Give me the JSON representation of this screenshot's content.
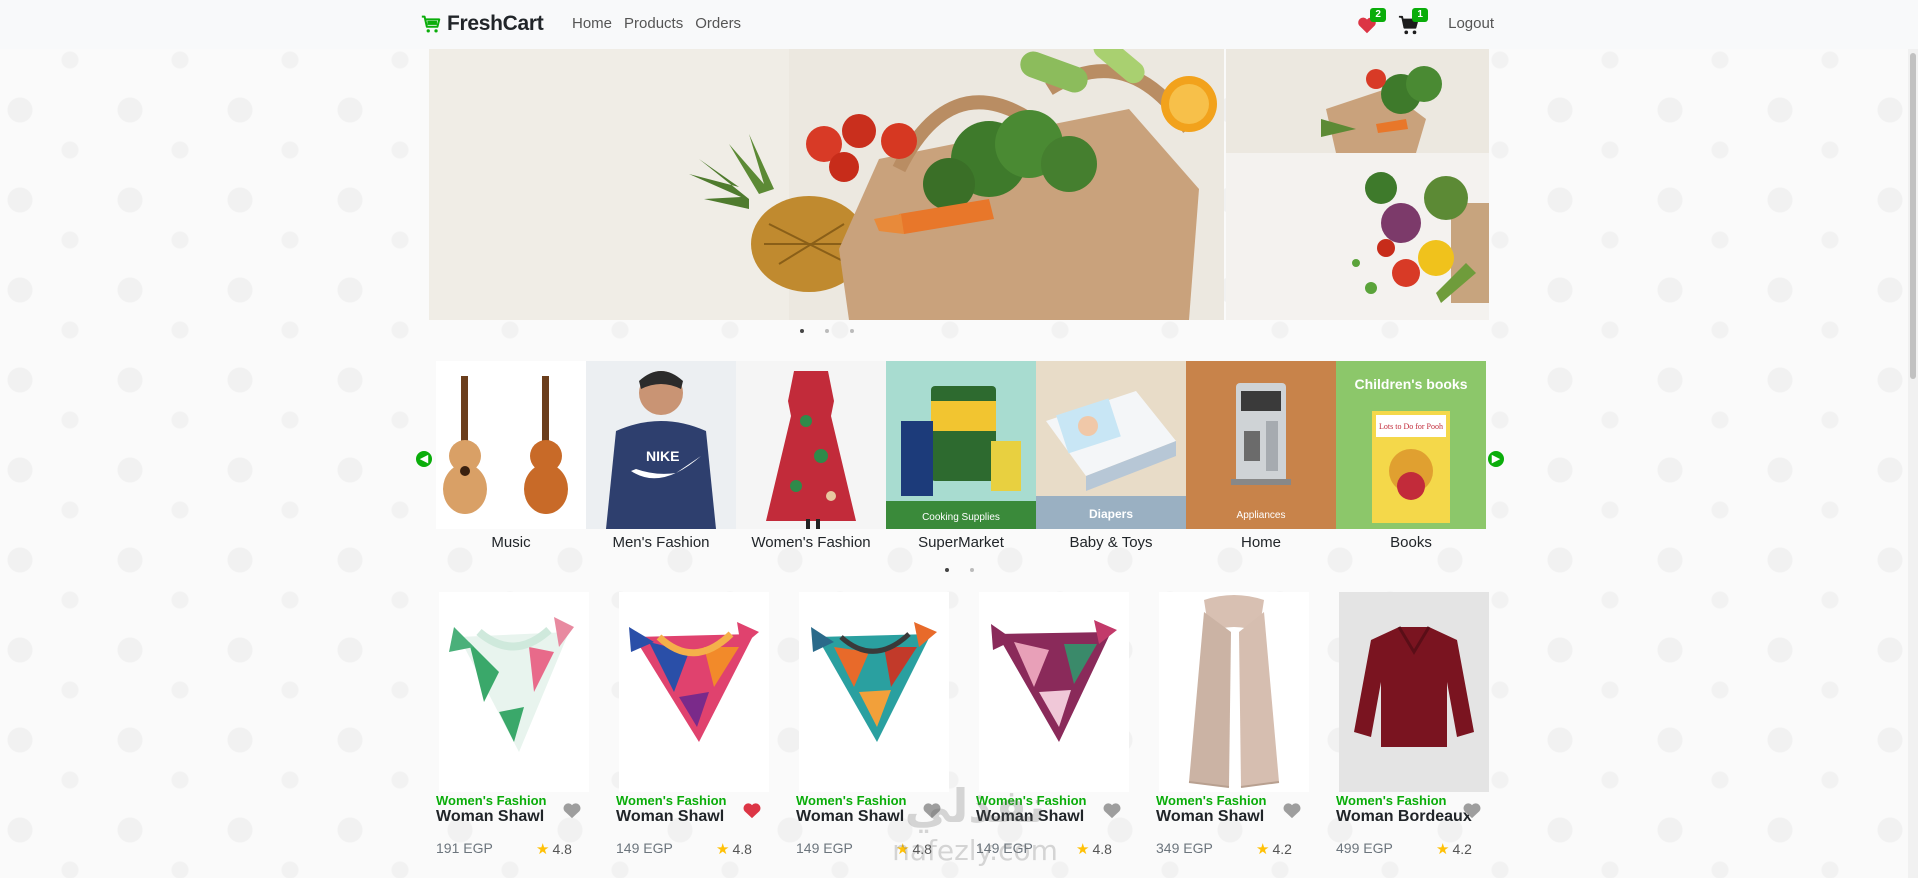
{
  "navbar": {
    "brand": "FreshCart",
    "links": [
      "Home",
      "Products",
      "Orders"
    ],
    "wishlist_count": "2",
    "cart_count": "1",
    "logout": "Logout"
  },
  "hero": {
    "dots": 3,
    "active_dot": 0
  },
  "categories": {
    "items": [
      "Music",
      "Men's Fashion",
      "Women's Fashion",
      "SuperMarket",
      "Baby & Toys",
      "Home",
      "Books"
    ],
    "image_captions": {
      "supermarket": "Cooking Supplies",
      "baby": "Diapers",
      "home": "Appliances",
      "books_banner": "Children's books",
      "book_cover": "Lots to Do for Pooh",
      "hoodie_brand": "NIKE"
    },
    "dots": 2,
    "active_dot": 0
  },
  "products": [
    {
      "category": "Women's Fashion",
      "name": "Woman Shawl",
      "price": "191 EGP",
      "rating": "4.8",
      "wishlisted": false
    },
    {
      "category": "Women's Fashion",
      "name": "Woman Shawl",
      "price": "149 EGP",
      "rating": "4.8",
      "wishlisted": true
    },
    {
      "category": "Women's Fashion",
      "name": "Woman Shawl",
      "price": "149 EGP",
      "rating": "4.8",
      "wishlisted": false
    },
    {
      "category": "Women's Fashion",
      "name": "Woman Shawl",
      "price": "149 EGP",
      "rating": "4.8",
      "wishlisted": false
    },
    {
      "category": "Women's Fashion",
      "name": "Woman Shawl",
      "price": "349 EGP",
      "rating": "4.2",
      "wishlisted": false
    },
    {
      "category": "Women's Fashion",
      "name": "Woman Bordeaux",
      "price": "499 EGP",
      "rating": "4.2",
      "wishlisted": false
    }
  ],
  "watermark": {
    "arabic": "نفذلي",
    "latin": "nafezly.com"
  },
  "colors": {
    "accent": "#0aad0a",
    "heart_active": "#dc3545",
    "heart_inactive": "#9e9e9e",
    "star": "#ffc107"
  }
}
